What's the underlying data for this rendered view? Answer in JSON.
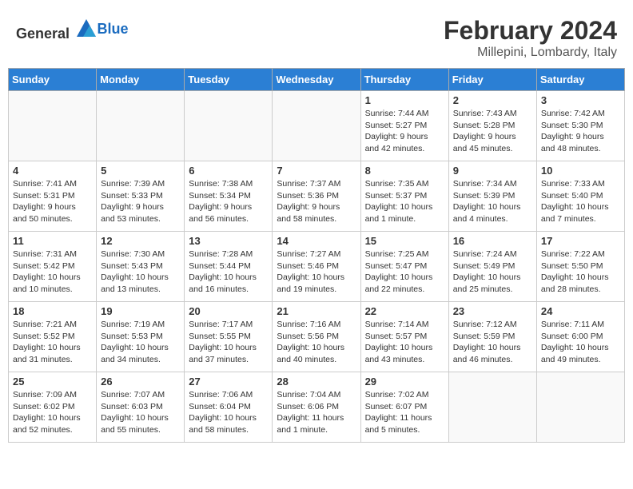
{
  "header": {
    "logo_general": "General",
    "logo_blue": "Blue",
    "month_year": "February 2024",
    "location": "Millepini, Lombardy, Italy"
  },
  "weekdays": [
    "Sunday",
    "Monday",
    "Tuesday",
    "Wednesday",
    "Thursday",
    "Friday",
    "Saturday"
  ],
  "weeks": [
    [
      {
        "day": "",
        "info": ""
      },
      {
        "day": "",
        "info": ""
      },
      {
        "day": "",
        "info": ""
      },
      {
        "day": "",
        "info": ""
      },
      {
        "day": "1",
        "info": "Sunrise: 7:44 AM\nSunset: 5:27 PM\nDaylight: 9 hours\nand 42 minutes."
      },
      {
        "day": "2",
        "info": "Sunrise: 7:43 AM\nSunset: 5:28 PM\nDaylight: 9 hours\nand 45 minutes."
      },
      {
        "day": "3",
        "info": "Sunrise: 7:42 AM\nSunset: 5:30 PM\nDaylight: 9 hours\nand 48 minutes."
      }
    ],
    [
      {
        "day": "4",
        "info": "Sunrise: 7:41 AM\nSunset: 5:31 PM\nDaylight: 9 hours\nand 50 minutes."
      },
      {
        "day": "5",
        "info": "Sunrise: 7:39 AM\nSunset: 5:33 PM\nDaylight: 9 hours\nand 53 minutes."
      },
      {
        "day": "6",
        "info": "Sunrise: 7:38 AM\nSunset: 5:34 PM\nDaylight: 9 hours\nand 56 minutes."
      },
      {
        "day": "7",
        "info": "Sunrise: 7:37 AM\nSunset: 5:36 PM\nDaylight: 9 hours\nand 58 minutes."
      },
      {
        "day": "8",
        "info": "Sunrise: 7:35 AM\nSunset: 5:37 PM\nDaylight: 10 hours\nand 1 minute."
      },
      {
        "day": "9",
        "info": "Sunrise: 7:34 AM\nSunset: 5:39 PM\nDaylight: 10 hours\nand 4 minutes."
      },
      {
        "day": "10",
        "info": "Sunrise: 7:33 AM\nSunset: 5:40 PM\nDaylight: 10 hours\nand 7 minutes."
      }
    ],
    [
      {
        "day": "11",
        "info": "Sunrise: 7:31 AM\nSunset: 5:42 PM\nDaylight: 10 hours\nand 10 minutes."
      },
      {
        "day": "12",
        "info": "Sunrise: 7:30 AM\nSunset: 5:43 PM\nDaylight: 10 hours\nand 13 minutes."
      },
      {
        "day": "13",
        "info": "Sunrise: 7:28 AM\nSunset: 5:44 PM\nDaylight: 10 hours\nand 16 minutes."
      },
      {
        "day": "14",
        "info": "Sunrise: 7:27 AM\nSunset: 5:46 PM\nDaylight: 10 hours\nand 19 minutes."
      },
      {
        "day": "15",
        "info": "Sunrise: 7:25 AM\nSunset: 5:47 PM\nDaylight: 10 hours\nand 22 minutes."
      },
      {
        "day": "16",
        "info": "Sunrise: 7:24 AM\nSunset: 5:49 PM\nDaylight: 10 hours\nand 25 minutes."
      },
      {
        "day": "17",
        "info": "Sunrise: 7:22 AM\nSunset: 5:50 PM\nDaylight: 10 hours\nand 28 minutes."
      }
    ],
    [
      {
        "day": "18",
        "info": "Sunrise: 7:21 AM\nSunset: 5:52 PM\nDaylight: 10 hours\nand 31 minutes."
      },
      {
        "day": "19",
        "info": "Sunrise: 7:19 AM\nSunset: 5:53 PM\nDaylight: 10 hours\nand 34 minutes."
      },
      {
        "day": "20",
        "info": "Sunrise: 7:17 AM\nSunset: 5:55 PM\nDaylight: 10 hours\nand 37 minutes."
      },
      {
        "day": "21",
        "info": "Sunrise: 7:16 AM\nSunset: 5:56 PM\nDaylight: 10 hours\nand 40 minutes."
      },
      {
        "day": "22",
        "info": "Sunrise: 7:14 AM\nSunset: 5:57 PM\nDaylight: 10 hours\nand 43 minutes."
      },
      {
        "day": "23",
        "info": "Sunrise: 7:12 AM\nSunset: 5:59 PM\nDaylight: 10 hours\nand 46 minutes."
      },
      {
        "day": "24",
        "info": "Sunrise: 7:11 AM\nSunset: 6:00 PM\nDaylight: 10 hours\nand 49 minutes."
      }
    ],
    [
      {
        "day": "25",
        "info": "Sunrise: 7:09 AM\nSunset: 6:02 PM\nDaylight: 10 hours\nand 52 minutes."
      },
      {
        "day": "26",
        "info": "Sunrise: 7:07 AM\nSunset: 6:03 PM\nDaylight: 10 hours\nand 55 minutes."
      },
      {
        "day": "27",
        "info": "Sunrise: 7:06 AM\nSunset: 6:04 PM\nDaylight: 10 hours\nand 58 minutes."
      },
      {
        "day": "28",
        "info": "Sunrise: 7:04 AM\nSunset: 6:06 PM\nDaylight: 11 hours\nand 1 minute."
      },
      {
        "day": "29",
        "info": "Sunrise: 7:02 AM\nSunset: 6:07 PM\nDaylight: 11 hours\nand 5 minutes."
      },
      {
        "day": "",
        "info": ""
      },
      {
        "day": "",
        "info": ""
      }
    ]
  ]
}
